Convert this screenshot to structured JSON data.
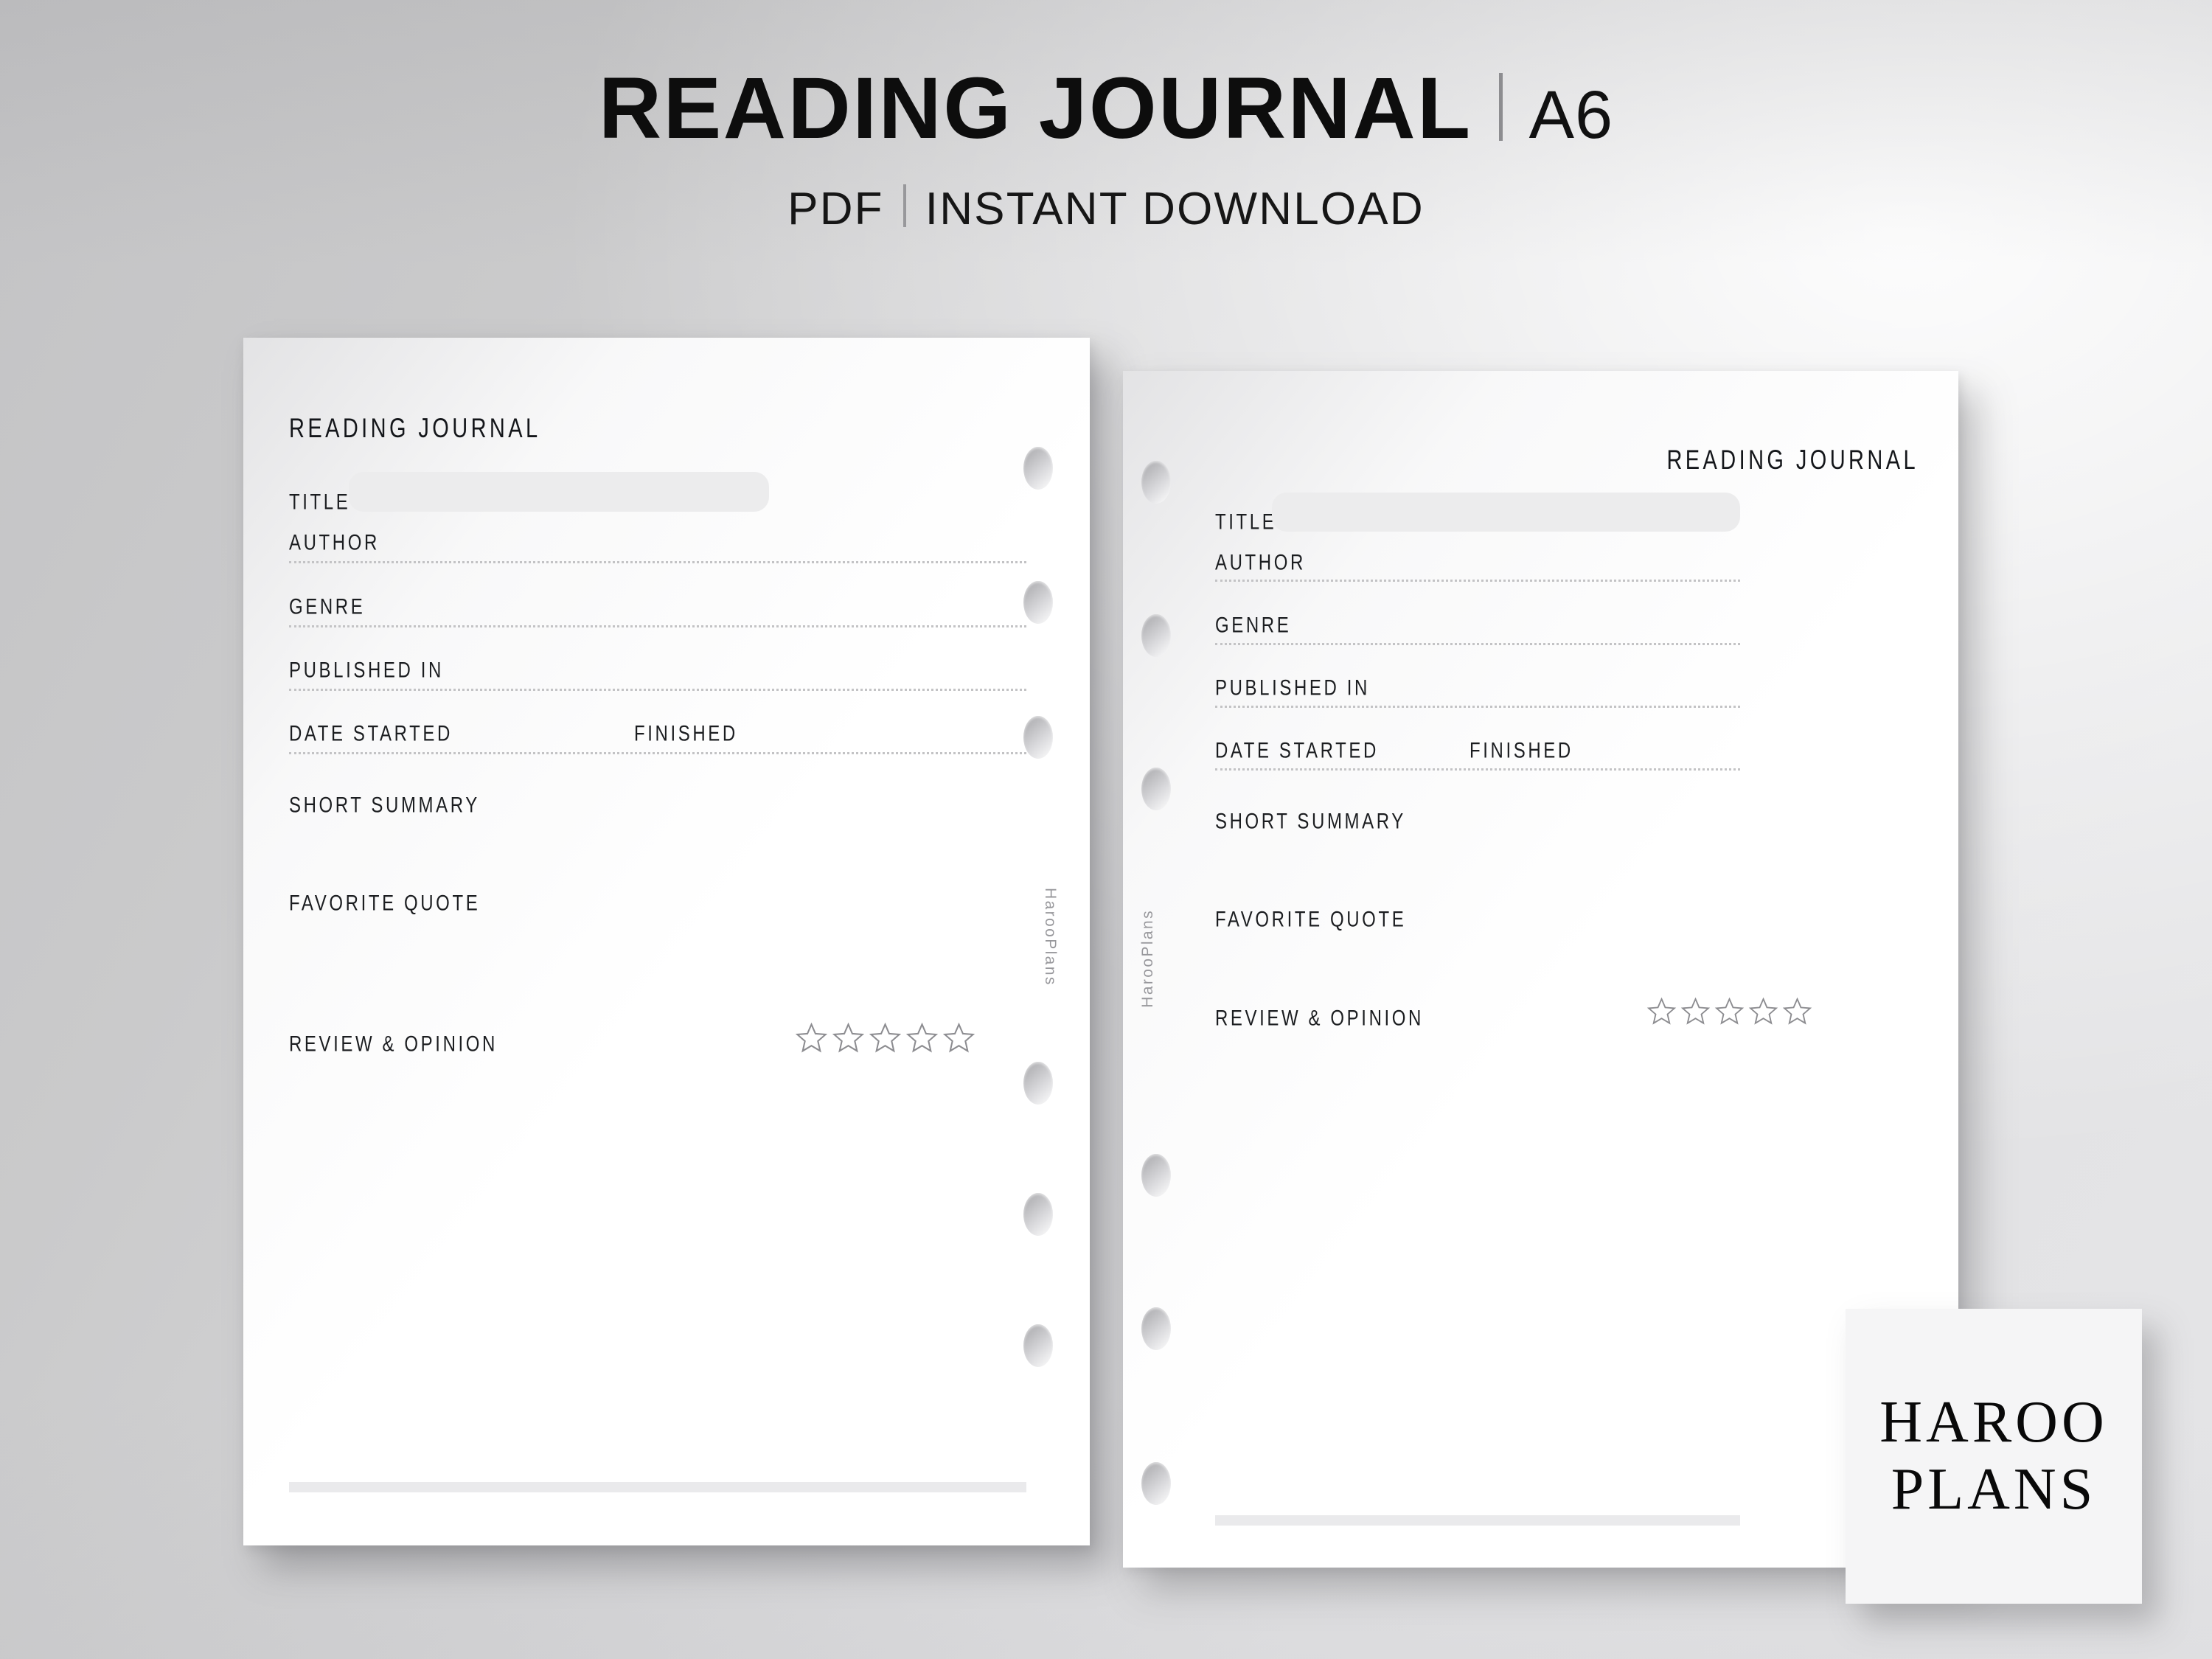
{
  "header": {
    "title": "READING JOURNAL",
    "divider": "|",
    "size_label": "A6",
    "subtitle_left": "PDF",
    "subtitle_divider": "|",
    "subtitle_right": "INSTANT DOWNLOAD"
  },
  "colors": {
    "background_start": "#c3c3c5",
    "background_end": "#e5e5e7",
    "page": "#ffffff",
    "title_field_fill": "#ececed",
    "rule": "#c3c3c5",
    "star_outline": "#8c8c90",
    "brand_text": "#98989c",
    "logo_tile": "#f5f5f6",
    "ink": "#14161a"
  },
  "left_page": {
    "sheet_title": "READING JOURNAL",
    "brand": "HarooPlans",
    "hole_count": 6,
    "fields": [
      {
        "label": "TITLE",
        "type": "boxed-input"
      },
      {
        "label": "AUTHOR",
        "type": "dotted-line"
      },
      {
        "label": "GENRE",
        "type": "dotted-line"
      },
      {
        "label": "PUBLISHED IN",
        "type": "dotted-line"
      },
      {
        "label": "DATE STARTED",
        "type": "dotted-line"
      },
      {
        "label": "FINISHED",
        "type": "inline"
      },
      {
        "label": "SHORT SUMMARY",
        "type": "open-area"
      },
      {
        "label": "FAVORITE QUOTE",
        "type": "open-area"
      },
      {
        "label": "REVIEW & OPINION",
        "type": "rating"
      }
    ],
    "rating": {
      "max": 5,
      "value": 0
    }
  },
  "right_page": {
    "sheet_title": "READING JOURNAL",
    "brand": "HarooPlans",
    "hole_count": 6,
    "fields": [
      {
        "label": "TITLE",
        "type": "boxed-input"
      },
      {
        "label": "AUTHOR",
        "type": "dotted-line"
      },
      {
        "label": "GENRE",
        "type": "dotted-line"
      },
      {
        "label": "PUBLISHED IN",
        "type": "dotted-line"
      },
      {
        "label": "DATE STARTED",
        "type": "dotted-line"
      },
      {
        "label": "FINISHED",
        "type": "inline"
      },
      {
        "label": "SHORT SUMMARY",
        "type": "open-area"
      },
      {
        "label": "FAVORITE QUOTE",
        "type": "open-area"
      },
      {
        "label": "REVIEW & OPINION",
        "type": "rating"
      }
    ],
    "rating": {
      "max": 5,
      "value": 0
    }
  },
  "logo": {
    "line1": "HAROO",
    "line2": "PLANS"
  }
}
